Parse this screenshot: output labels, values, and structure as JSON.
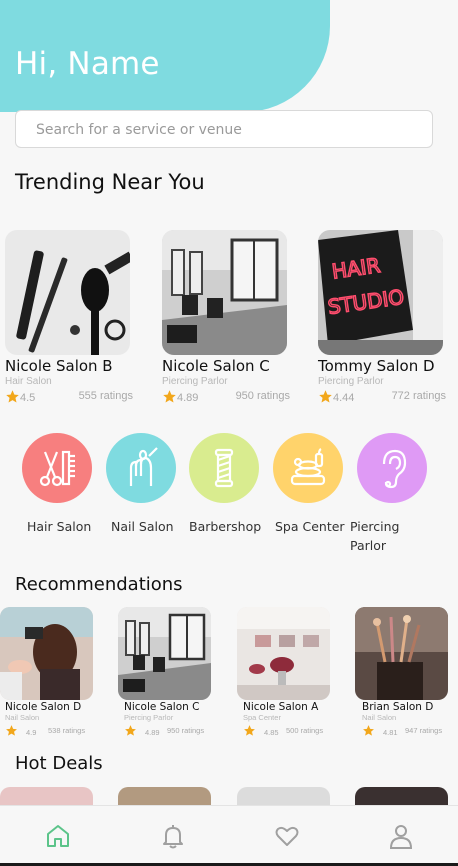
{
  "header": {
    "greeting": "Hi, Name",
    "accent_color": "#7fdbe0"
  },
  "search": {
    "placeholder": "Search for a service or venue"
  },
  "sections": {
    "trending": "Trending Near You",
    "recommendations": "Recommendations",
    "hot_deals": "Hot Deals"
  },
  "trending": [
    {
      "name": "Nicole Salon B",
      "type": "Hair Salon",
      "rating": "4.5",
      "ratings_count": "555 ratings"
    },
    {
      "name": "Nicole Salon C",
      "type": "Piercing Parlor",
      "rating": "4.89",
      "ratings_count": "950 ratings"
    },
    {
      "name": "Tommy Salon D",
      "type": "Piercing Parlor",
      "rating": "4.44",
      "ratings_count": "772 ratings"
    }
  ],
  "categories": [
    {
      "label": "Hair Salon",
      "icon": "scissors-comb-icon",
      "color": "#f77f7f"
    },
    {
      "label": "Nail Salon",
      "icon": "nail-hand-icon",
      "color": "#7fdbe0"
    },
    {
      "label": "Barbershop",
      "icon": "barber-pole-icon",
      "color": "#d9ec8f"
    },
    {
      "label": "Spa Center",
      "icon": "spa-stones-icon",
      "color": "#ffd36b"
    },
    {
      "label": "Piercing\nParlor",
      "icon": "ear-icon",
      "color": "#df9af5"
    }
  ],
  "recommendations": [
    {
      "name": "Nicole Salon D",
      "type": "Nail Salon",
      "rating": "4.9",
      "ratings_count": "538 ratings"
    },
    {
      "name": "Nicole Salon C",
      "type": "Piercing Parlor",
      "rating": "4.89",
      "ratings_count": "950 ratings"
    },
    {
      "name": "Nicole Salon A",
      "type": "Spa Center",
      "rating": "4.85",
      "ratings_count": "500 ratings"
    },
    {
      "name": "Brian Salon D",
      "type": "Nail Salon",
      "rating": "4.81",
      "ratings_count": "947 ratings"
    }
  ],
  "nav": {
    "items": [
      "home-icon",
      "bell-icon",
      "heart-icon",
      "profile-icon"
    ],
    "active_color": "#5cc48a",
    "inactive_color": "#a0a0a0"
  },
  "star_color": "#f2a71b"
}
